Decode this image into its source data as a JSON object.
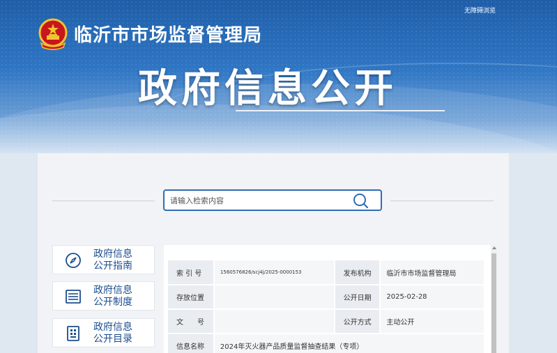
{
  "header": {
    "accessibility_link": "无障碍浏览",
    "org_name": "临沂市市场监督管理局",
    "site_title": "政府信息公开"
  },
  "search": {
    "placeholder": "请输入检索内容",
    "value": ""
  },
  "sidebar": {
    "items": [
      {
        "label_line1": "政府信息",
        "label_line2": "公开指南",
        "icon": "compass-icon"
      },
      {
        "label_line1": "政府信息",
        "label_line2": "公开制度",
        "icon": "list-document-icon"
      },
      {
        "label_line1": "政府信息",
        "label_line2": "公开目录",
        "icon": "grid-document-icon"
      }
    ]
  },
  "meta": {
    "rows": [
      {
        "k1": "索 引 号",
        "v1": "1560576826/scj4j/2025-0000153",
        "k2": "发布机构",
        "v2": "临沂市市场监督管理局"
      },
      {
        "k1": "存放位置",
        "v1": "",
        "k2": "公开日期",
        "v2": "2025-02-28"
      },
      {
        "k1": "文　　号",
        "v1": "",
        "k2": "公开方式",
        "v2": "主动公开"
      },
      {
        "k1": "信息名称",
        "v1": "2024年灭火器产品质量监督抽查结果（专项）",
        "k2": "",
        "v2": ""
      }
    ]
  },
  "colors": {
    "banner_blue": "#2f76c4",
    "accent": "#2f6db5",
    "nav_text": "#1a4d8f"
  }
}
